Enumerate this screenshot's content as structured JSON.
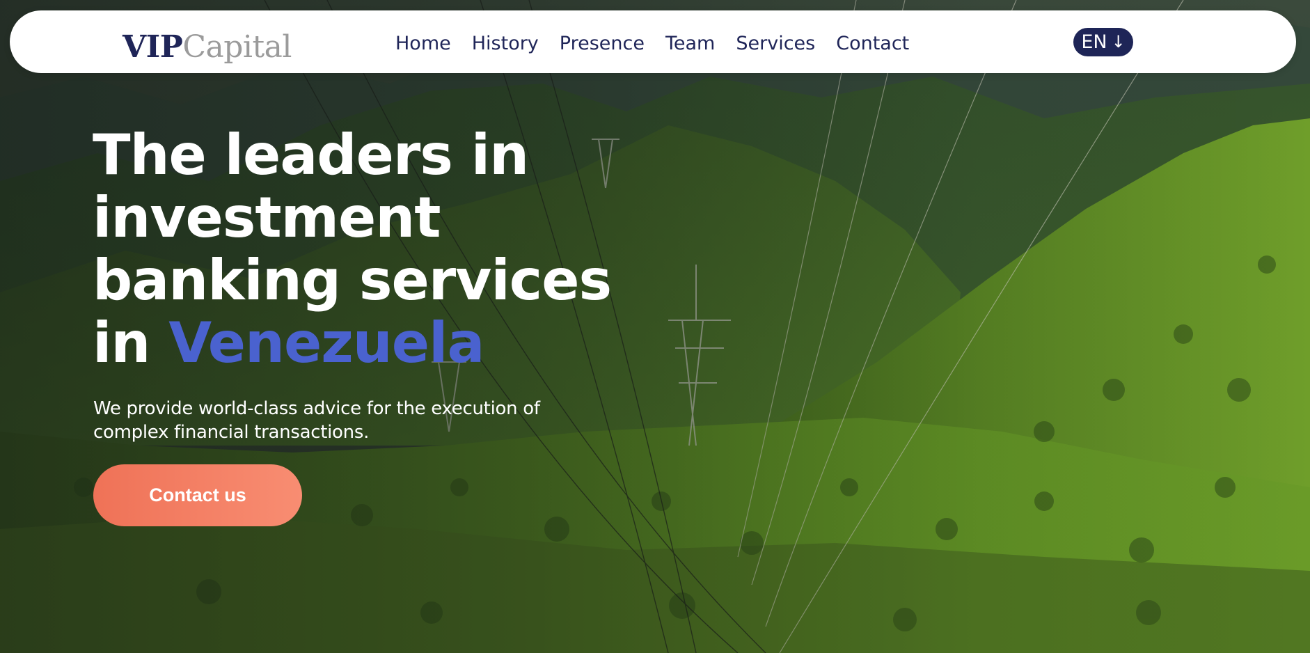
{
  "brand": {
    "name_strong": "VIP",
    "name_light": "Capital"
  },
  "nav": {
    "items": [
      {
        "label": "Home"
      },
      {
        "label": "History"
      },
      {
        "label": "Presence"
      },
      {
        "label": "Team"
      },
      {
        "label": "Services"
      },
      {
        "label": "Contact"
      }
    ],
    "language": {
      "label": "EN",
      "icon": "arrow-down-icon"
    }
  },
  "hero": {
    "title_line1": "The leaders in",
    "title_line2": "investment",
    "title_line3": "banking services",
    "title_line4_prefix": "in ",
    "title_accent": "Venezuela",
    "subtitle_line1": "We provide world-class advice for the execution of",
    "subtitle_line2": "complex financial transactions.",
    "cta_label": "Contact us"
  },
  "colors": {
    "navy": "#1f2558",
    "accent_blue": "#4a62cf",
    "cta_start": "#ef7257",
    "cta_end": "#f88d72",
    "logo_gray": "#9b9b9b"
  }
}
